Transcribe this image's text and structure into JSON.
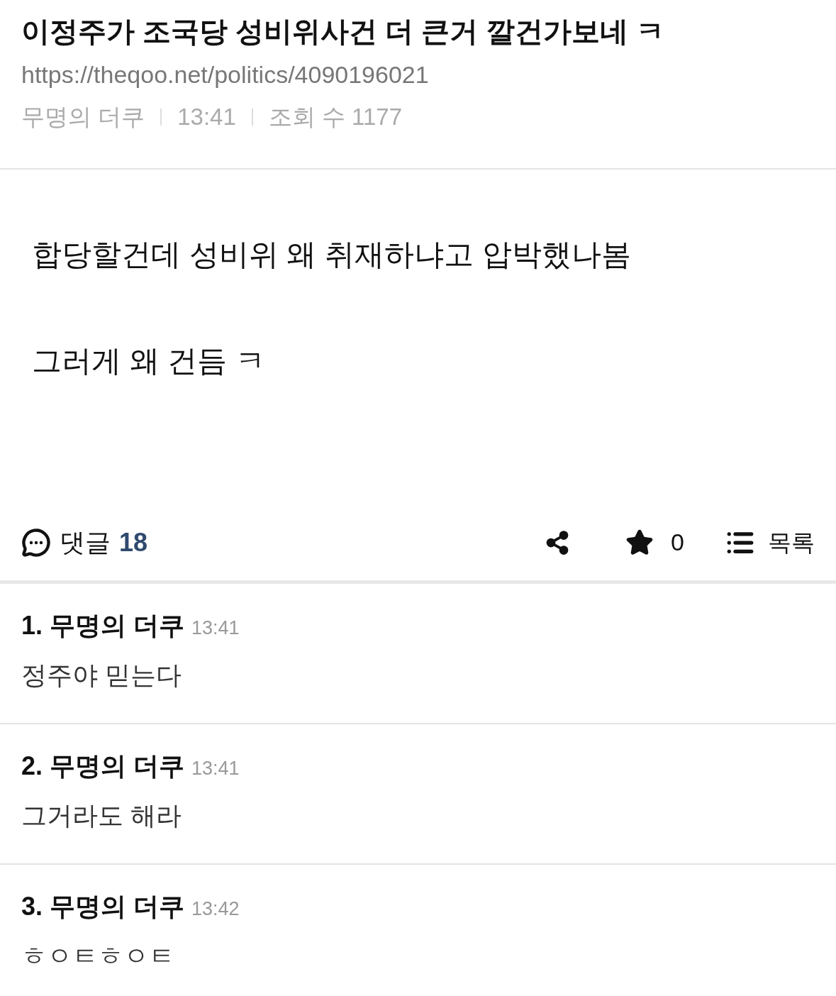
{
  "post": {
    "title": "이정주가 조국당 성비위사건 더 큰거 깔건가보네 ㅋ",
    "url": "https://theqoo.net/politics/4090196021",
    "author": "무명의 더쿠",
    "time": "13:41",
    "views": "조회 수 1177"
  },
  "body": [
    "합당할건데 성비위 왜 취재하냐고 압박했나봄",
    "그러게 왜 건듬 ㅋ"
  ],
  "actions": {
    "comments_label": "댓글",
    "comments_count": "18",
    "star_count": "0",
    "list_label": "목록"
  },
  "comments": [
    {
      "number": "1.",
      "author": "무명의 더쿠",
      "time": "13:41",
      "text": "정주야 믿는다"
    },
    {
      "number": "2.",
      "author": "무명의 더쿠",
      "time": "13:41",
      "text": "그거라도 해라"
    },
    {
      "number": "3.",
      "author": "무명의 더쿠",
      "time": "13:42",
      "text": "ㅎㅇㅌㅎㅇㅌ"
    }
  ]
}
